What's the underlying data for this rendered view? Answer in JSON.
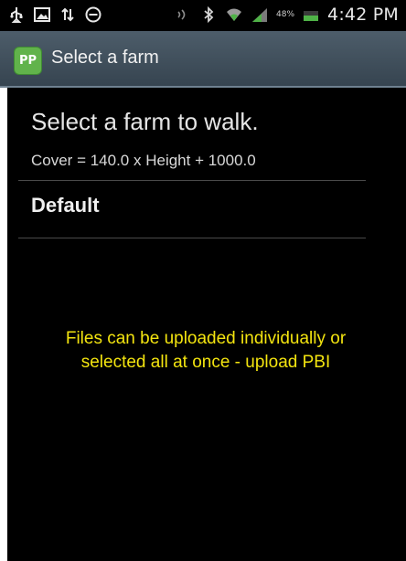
{
  "status_bar": {
    "icons_left": [
      "usb-icon",
      "image-notification-icon",
      "data-transfer-icon",
      "do-not-disturb-icon"
    ],
    "icons_right": [
      "nfc-icon",
      "bluetooth-icon",
      "wifi-icon",
      "signal-icon",
      "battery-icon"
    ],
    "battery_percent": "48%",
    "time": "4:42 PM"
  },
  "action_bar": {
    "app_icon_text": "PP",
    "title": "Select a farm",
    "colors": {
      "bar": "#3f4d59",
      "app_icon": "#61b34b"
    }
  },
  "main": {
    "heading": "Select a farm to walk.",
    "formula": "Cover = 140.0 x Height + 1000.0",
    "farms": [
      "Default"
    ],
    "caption_line1": "Files can be uploaded individually or",
    "caption_line2": "selected all at once - upload PBI",
    "colors": {
      "caption": "#f3e40f"
    }
  }
}
